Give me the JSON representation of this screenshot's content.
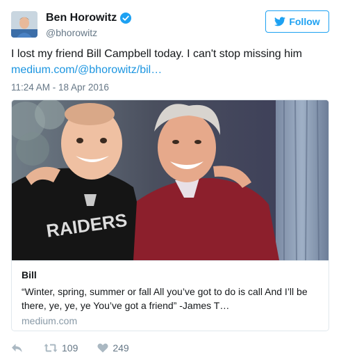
{
  "user": {
    "display_name": "Ben Horowitz",
    "handle": "@bhorowitz",
    "verified": true
  },
  "follow_button": {
    "label": "Follow"
  },
  "tweet": {
    "text": "I lost my friend Bill Campbell today. I can't stop missing him",
    "link": "medium.com/@bhorowitz/bil…",
    "timestamp": "11:24 AM - 18 Apr 2016"
  },
  "card": {
    "jersey_text": "RAIDERS",
    "title": "Bill",
    "description": "“Winter, spring, summer or fall All you’ve got to do is call And I’ll be there, ye, ye, ye You’ve got a friend” -James T…",
    "domain": "medium.com"
  },
  "actions": {
    "reply_icon": "reply-icon",
    "retweet_icon": "retweet-icon",
    "retweet_count": "109",
    "like_icon": "heart-icon",
    "like_count": "249"
  },
  "colors": {
    "brand_blue": "#1da1f2",
    "link_blue": "#1b95e0",
    "secondary_text": "#657786",
    "action_gray": "#aab8c2"
  }
}
